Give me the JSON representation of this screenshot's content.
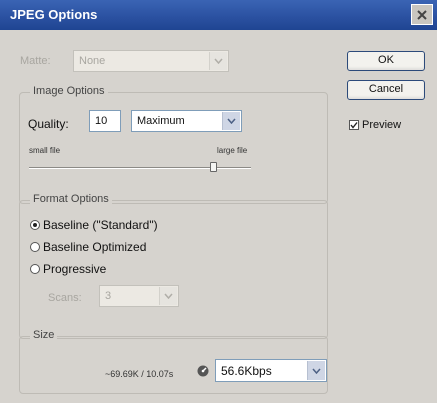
{
  "window": {
    "title": "JPEG Options"
  },
  "matte": {
    "label": "Matte:",
    "value": "None"
  },
  "buttons": {
    "ok": "OK",
    "cancel": "Cancel"
  },
  "preview": {
    "label": "Preview",
    "checked": true
  },
  "image_options": {
    "legend": "Image Options",
    "quality_label": "Quality:",
    "quality_value": "10",
    "quality_preset": "Maximum",
    "slider_left_label": "small file",
    "slider_right_label": "large file",
    "slider_fraction": 0.83
  },
  "format_options": {
    "legend": "Format Options",
    "options": [
      "Baseline (\"Standard\")",
      "Baseline Optimized",
      "Progressive"
    ],
    "selected_index": 0,
    "scans_label": "Scans:",
    "scans_value": "3"
  },
  "size": {
    "legend": "Size",
    "estimate": "~69.69K / 10.07s",
    "speed_value": "56.6Kbps"
  }
}
